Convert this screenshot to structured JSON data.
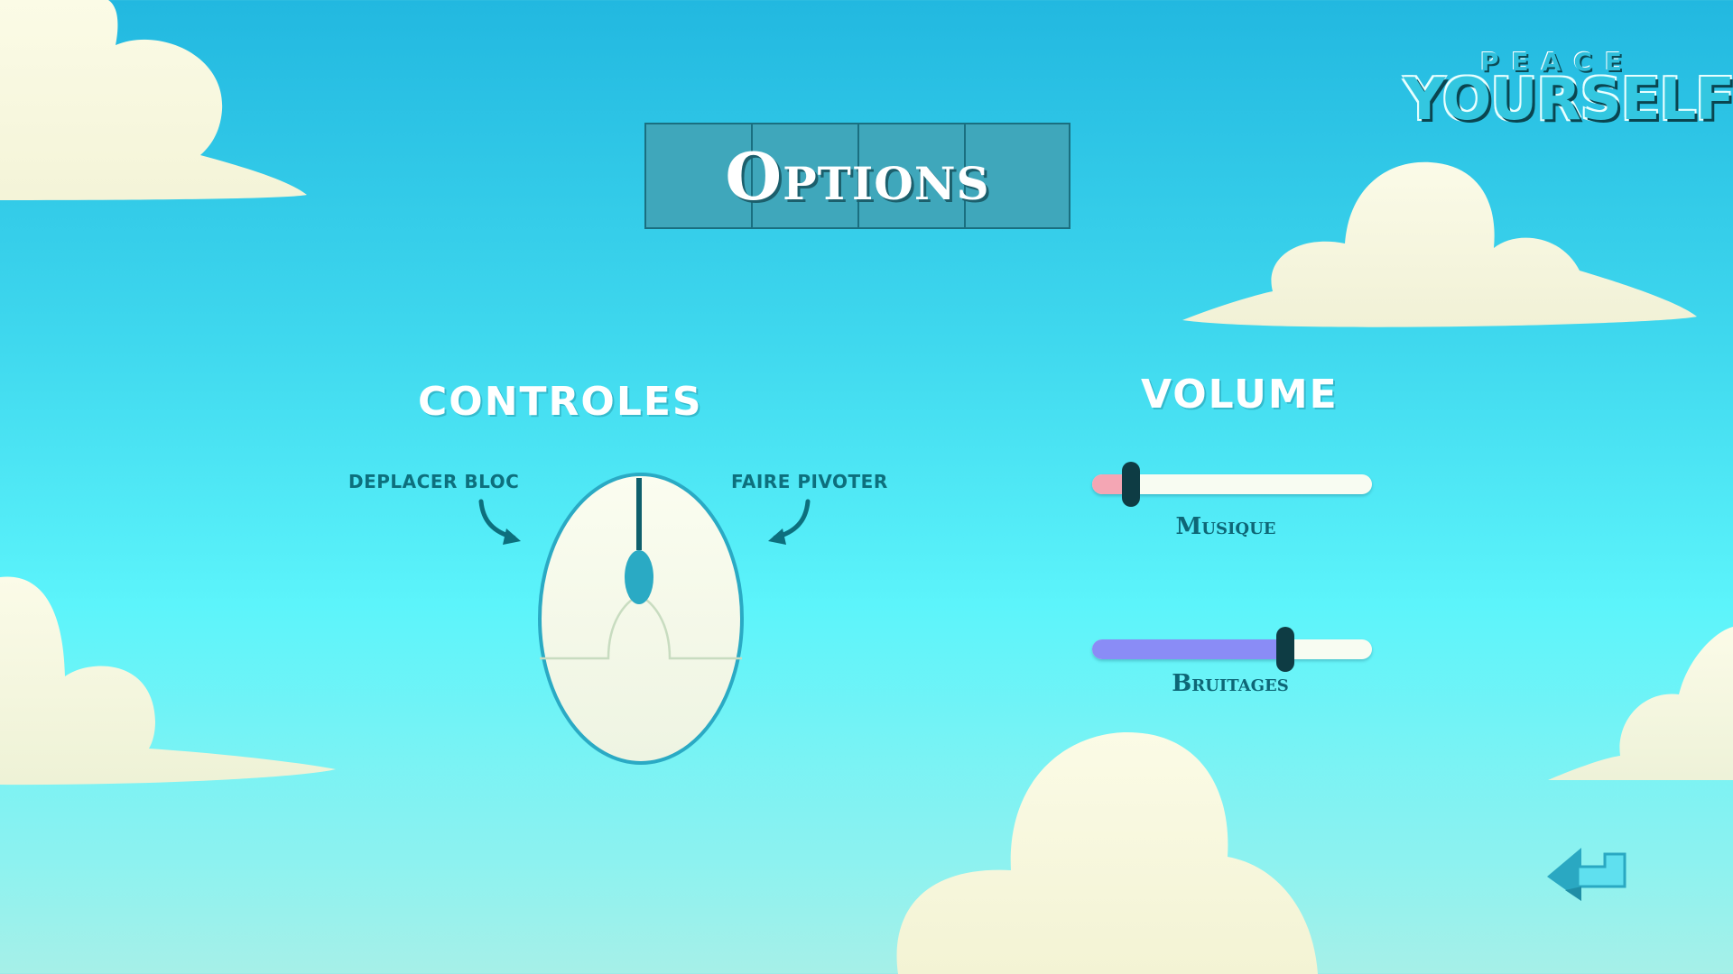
{
  "logo": {
    "top_word": "PEACE",
    "main_word": "YOURSELF"
  },
  "title": "Options",
  "controls": {
    "heading": "CONTROLES",
    "left_label": "DEPLACER BLOC",
    "right_label": "FAIRE PIVOTER"
  },
  "volume": {
    "heading": "VOLUME",
    "sliders": [
      {
        "label": "Musique",
        "value": 0.14,
        "color": "#f4a6b4"
      },
      {
        "label": "Bruitages",
        "value": 0.69,
        "color": "#8a8cf6"
      }
    ]
  },
  "colors": {
    "accent": "#2fb3cc",
    "dark": "#0e3c44",
    "title_box": "#3fa7bb"
  },
  "icons": {
    "back": "back-arrow-icon",
    "mouse": "mouse-icon"
  }
}
